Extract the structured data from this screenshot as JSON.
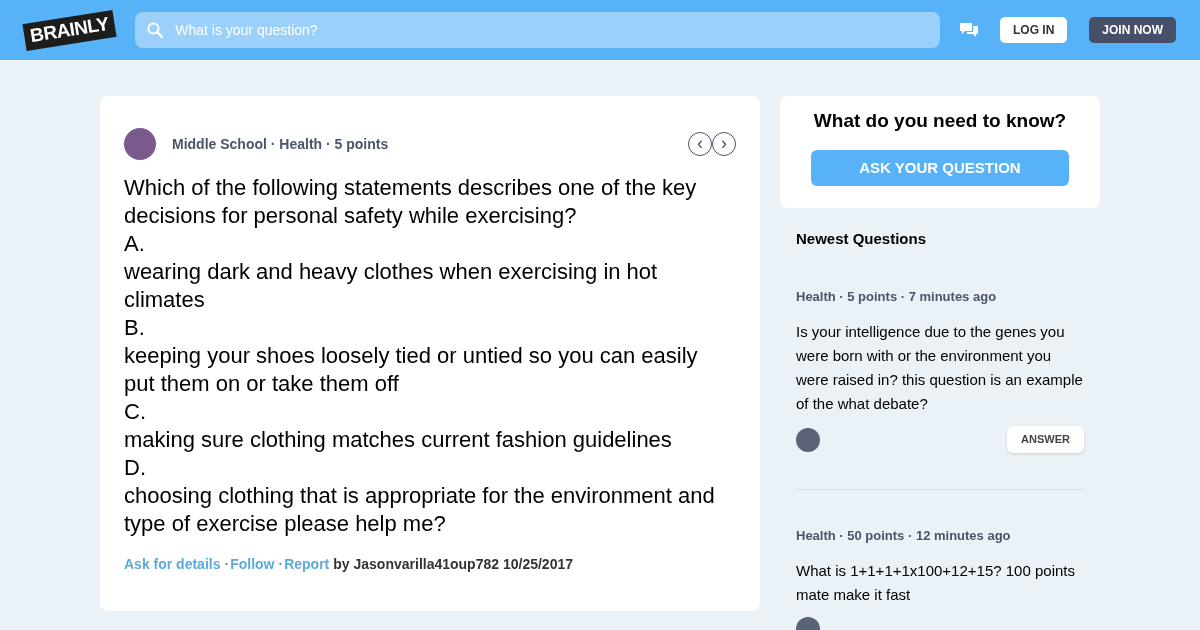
{
  "header": {
    "logo": "BRAINLY",
    "search": {
      "placeholder": "What is your question?"
    },
    "buttons": [
      {
        "label": "LOG IN",
        "kind": "light"
      },
      {
        "label": "JOIN NOW",
        "kind": "dark"
      }
    ]
  },
  "question": {
    "meta": "Middle School · Health · 5 points",
    "nav": [
      "‹",
      "›"
    ],
    "lines": [
      "Which of the following statements describes one of the key decisions for personal safety while exercising?",
      "A.",
      "wearing dark and heavy clothes when exercising in hot climates",
      "B.",
      "keeping your shoes loosely tied or untied so you can easily put them on or take them off",
      "C.",
      "making sure clothing matches current fashion guidelines",
      "D.",
      "choosing clothing that is appropriate for the environment and type of exercise please help me?"
    ],
    "footer": [
      {
        "kind": "link",
        "text": "Ask for details"
      },
      {
        "kind": "sep",
        "text": "·"
      },
      {
        "kind": "link",
        "text": "Follow"
      },
      {
        "kind": "sep",
        "text": "·"
      },
      {
        "kind": "link",
        "text": "Report"
      },
      {
        "kind": "text",
        "text": "by Jasonvarilla41oup782 10/25/2017"
      }
    ]
  },
  "ask_box": {
    "title": "What do you need to know?",
    "button": "ASK YOUR QUESTION"
  },
  "newest": {
    "title": "Newest Questions",
    "items": [
      {
        "meta": "Health · 5 points  · 7 minutes ago",
        "text": "Is your intelligence due to the genes you were born with or the environment you were raised in? this question is an example of the what debate?",
        "answer": "ANSWER"
      },
      {
        "meta": "Health · 50 points  · 12 minutes ago",
        "text": "What is 1+1+1+1x100+12+15? 100 points mate make it fast"
      }
    ]
  }
}
